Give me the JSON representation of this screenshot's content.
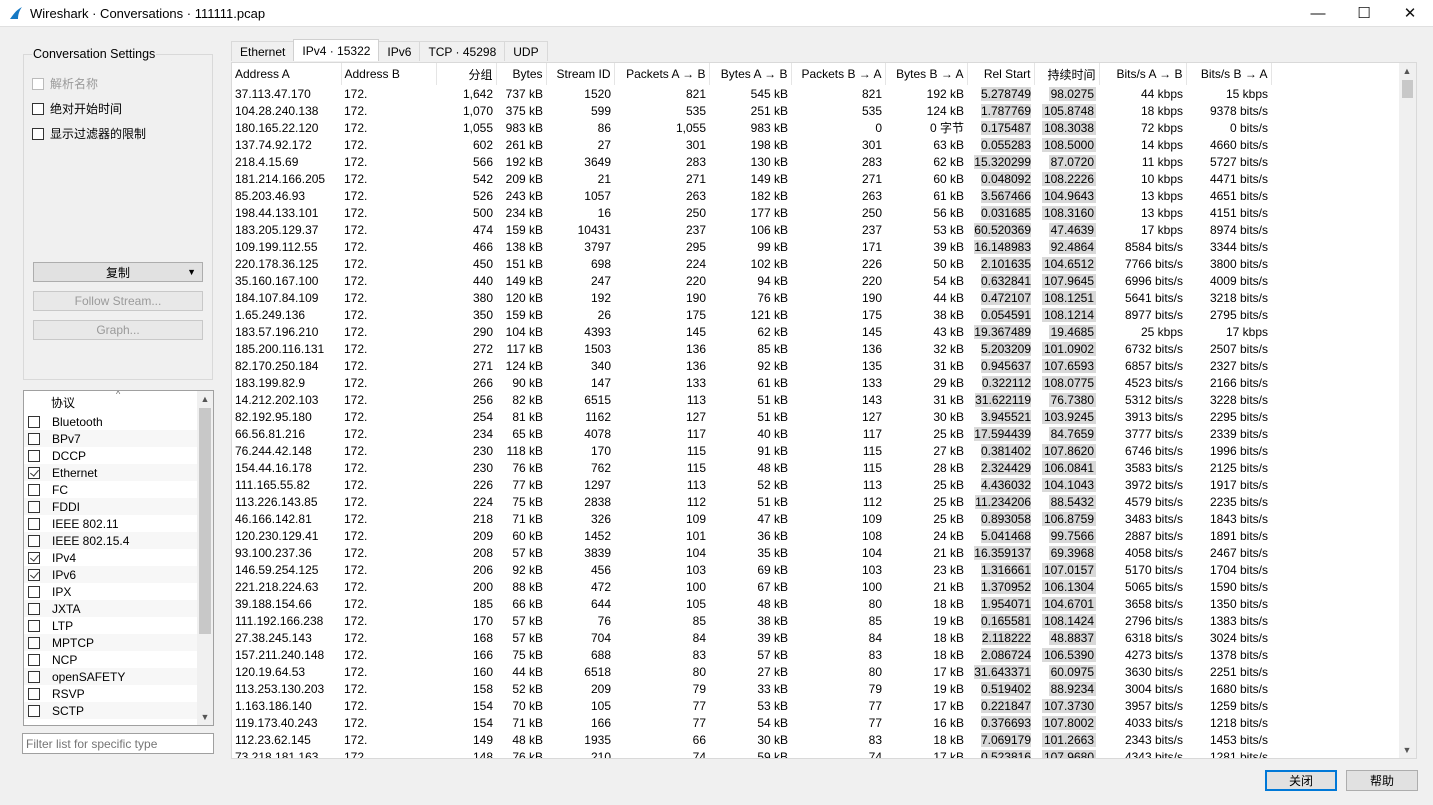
{
  "window": {
    "title": "Wireshark · Conversations · 111111.pcap",
    "minimize": "—",
    "maximize": "☐",
    "close": "✕"
  },
  "settings": {
    "title": "Conversation Settings",
    "name_resolution": "解析名称",
    "absolute_time": "绝对开始时间",
    "limit_to_filter": "显示过滤器的限制",
    "copy_button": "复制",
    "follow_stream_button": "Follow Stream...",
    "graph_button": "Graph..."
  },
  "protocols": {
    "header": "协议",
    "items": [
      {
        "label": "Bluetooth",
        "checked": false
      },
      {
        "label": "BPv7",
        "checked": false
      },
      {
        "label": "DCCP",
        "checked": false
      },
      {
        "label": "Ethernet",
        "checked": true
      },
      {
        "label": "FC",
        "checked": false
      },
      {
        "label": "FDDI",
        "checked": false
      },
      {
        "label": "IEEE 802.11",
        "checked": false
      },
      {
        "label": "IEEE 802.15.4",
        "checked": false
      },
      {
        "label": "IPv4",
        "checked": true
      },
      {
        "label": "IPv6",
        "checked": true
      },
      {
        "label": "IPX",
        "checked": false
      },
      {
        "label": "JXTA",
        "checked": false
      },
      {
        "label": "LTP",
        "checked": false
      },
      {
        "label": "MPTCP",
        "checked": false
      },
      {
        "label": "NCP",
        "checked": false
      },
      {
        "label": "openSAFETY",
        "checked": false
      },
      {
        "label": "RSVP",
        "checked": false
      },
      {
        "label": "SCTP",
        "checked": false
      }
    ],
    "filter_placeholder": "Filter list for specific type"
  },
  "tabs": [
    "Ethernet",
    "IPv4 · 15322",
    "IPv6",
    "TCP · 45298",
    "UDP"
  ],
  "table": {
    "columns": [
      "Address A",
      "Address B",
      "分组",
      "Bytes",
      "Stream ID",
      "Packets A → B",
      "Bytes A → B",
      "Packets B → A",
      "Bytes B → A",
      "Rel Start",
      "持续时间",
      "Bits/s A → B",
      "Bits/s B → A"
    ],
    "rows": [
      [
        "37.113.47.170",
        "172.",
        "1,642",
        "737 kB",
        "1520",
        "821",
        "545 kB",
        "821",
        "192 kB",
        "5.278749",
        "98.0275",
        "44 kbps",
        "15 kbps"
      ],
      [
        "104.28.240.138",
        "172.",
        "1,070",
        "375 kB",
        "599",
        "535",
        "251 kB",
        "535",
        "124 kB",
        "1.787769",
        "105.8748",
        "18 kbps",
        "9378 bits/s"
      ],
      [
        "180.165.22.120",
        "172.",
        "1,055",
        "983 kB",
        "86",
        "1,055",
        "983 kB",
        "0",
        "0 字节",
        "0.175487",
        "108.3038",
        "72 kbps",
        "0 bits/s"
      ],
      [
        "137.74.92.172",
        "172.",
        "602",
        "261 kB",
        "27",
        "301",
        "198 kB",
        "301",
        "63 kB",
        "0.055283",
        "108.5000",
        "14 kbps",
        "4660 bits/s"
      ],
      [
        "218.4.15.69",
        "172.",
        "566",
        "192 kB",
        "3649",
        "283",
        "130 kB",
        "283",
        "62 kB",
        "15.320299",
        "87.0720",
        "11 kbps",
        "5727 bits/s"
      ],
      [
        "181.214.166.205",
        "172.",
        "542",
        "209 kB",
        "21",
        "271",
        "149 kB",
        "271",
        "60 kB",
        "0.048092",
        "108.2226",
        "10 kbps",
        "4471 bits/s"
      ],
      [
        "85.203.46.93",
        "172.",
        "526",
        "243 kB",
        "1057",
        "263",
        "182 kB",
        "263",
        "61 kB",
        "3.567466",
        "104.9643",
        "13 kbps",
        "4651 bits/s"
      ],
      [
        "198.44.133.101",
        "172.",
        "500",
        "234 kB",
        "16",
        "250",
        "177 kB",
        "250",
        "56 kB",
        "0.031685",
        "108.3160",
        "13 kbps",
        "4151 bits/s"
      ],
      [
        "183.205.129.37",
        "172.",
        "474",
        "159 kB",
        "10431",
        "237",
        "106 kB",
        "237",
        "53 kB",
        "60.520369",
        "47.4639",
        "17 kbps",
        "8974 bits/s"
      ],
      [
        "109.199.112.55",
        "172.",
        "466",
        "138 kB",
        "3797",
        "295",
        "99 kB",
        "171",
        "39 kB",
        "16.148983",
        "92.4864",
        "8584 bits/s",
        "3344 bits/s"
      ],
      [
        "220.178.36.125",
        "172.",
        "450",
        "151 kB",
        "698",
        "224",
        "102 kB",
        "226",
        "50 kB",
        "2.101635",
        "104.6512",
        "7766 bits/s",
        "3800 bits/s"
      ],
      [
        "35.160.167.100",
        "172.",
        "440",
        "149 kB",
        "247",
        "220",
        "94 kB",
        "220",
        "54 kB",
        "0.632841",
        "107.9645",
        "6996 bits/s",
        "4009 bits/s"
      ],
      [
        "184.107.84.109",
        "172.",
        "380",
        "120 kB",
        "192",
        "190",
        "76 kB",
        "190",
        "44 kB",
        "0.472107",
        "108.1251",
        "5641 bits/s",
        "3218 bits/s"
      ],
      [
        "1.65.249.136",
        "172.",
        "350",
        "159 kB",
        "26",
        "175",
        "121 kB",
        "175",
        "38 kB",
        "0.054591",
        "108.1214",
        "8977 bits/s",
        "2795 bits/s"
      ],
      [
        "183.57.196.210",
        "172.",
        "290",
        "104 kB",
        "4393",
        "145",
        "62 kB",
        "145",
        "43 kB",
        "19.367489",
        "19.4685",
        "25 kbps",
        "17 kbps"
      ],
      [
        "185.200.116.131",
        "172.",
        "272",
        "117 kB",
        "1503",
        "136",
        "85 kB",
        "136",
        "32 kB",
        "5.203209",
        "101.0902",
        "6732 bits/s",
        "2507 bits/s"
      ],
      [
        "82.170.250.184",
        "172.",
        "271",
        "124 kB",
        "340",
        "136",
        "92 kB",
        "135",
        "31 kB",
        "0.945637",
        "107.6593",
        "6857 bits/s",
        "2327 bits/s"
      ],
      [
        "183.199.82.9",
        "172.",
        "266",
        "90 kB",
        "147",
        "133",
        "61 kB",
        "133",
        "29 kB",
        "0.322112",
        "108.0775",
        "4523 bits/s",
        "2166 bits/s"
      ],
      [
        "14.212.202.103",
        "172.",
        "256",
        "82 kB",
        "6515",
        "113",
        "51 kB",
        "143",
        "31 kB",
        "31.622119",
        "76.7380",
        "5312 bits/s",
        "3228 bits/s"
      ],
      [
        "82.192.95.180",
        "172.",
        "254",
        "81 kB",
        "1162",
        "127",
        "51 kB",
        "127",
        "30 kB",
        "3.945521",
        "103.9245",
        "3913 bits/s",
        "2295 bits/s"
      ],
      [
        "66.56.81.216",
        "172.",
        "234",
        "65 kB",
        "4078",
        "117",
        "40 kB",
        "117",
        "25 kB",
        "17.594439",
        "84.7659",
        "3777 bits/s",
        "2339 bits/s"
      ],
      [
        "76.244.42.148",
        "172.",
        "230",
        "118 kB",
        "170",
        "115",
        "91 kB",
        "115",
        "27 kB",
        "0.381402",
        "107.8620",
        "6746 bits/s",
        "1996 bits/s"
      ],
      [
        "154.44.16.178",
        "172.",
        "230",
        "76 kB",
        "762",
        "115",
        "48 kB",
        "115",
        "28 kB",
        "2.324429",
        "106.0841",
        "3583 bits/s",
        "2125 bits/s"
      ],
      [
        "111.165.55.82",
        "172.",
        "226",
        "77 kB",
        "1297",
        "113",
        "52 kB",
        "113",
        "25 kB",
        "4.436032",
        "104.1043",
        "3972 bits/s",
        "1917 bits/s"
      ],
      [
        "113.226.143.85",
        "172.",
        "224",
        "75 kB",
        "2838",
        "112",
        "51 kB",
        "112",
        "25 kB",
        "11.234206",
        "88.5432",
        "4579 bits/s",
        "2235 bits/s"
      ],
      [
        "46.166.142.81",
        "172.",
        "218",
        "71 kB",
        "326",
        "109",
        "47 kB",
        "109",
        "25 kB",
        "0.893058",
        "106.8759",
        "3483 bits/s",
        "1843 bits/s"
      ],
      [
        "120.230.129.41",
        "172.",
        "209",
        "60 kB",
        "1452",
        "101",
        "36 kB",
        "108",
        "24 kB",
        "5.041468",
        "99.7566",
        "2887 bits/s",
        "1891 bits/s"
      ],
      [
        "93.100.237.36",
        "172.",
        "208",
        "57 kB",
        "3839",
        "104",
        "35 kB",
        "104",
        "21 kB",
        "16.359137",
        "69.3968",
        "4058 bits/s",
        "2467 bits/s"
      ],
      [
        "146.59.254.125",
        "172.",
        "206",
        "92 kB",
        "456",
        "103",
        "69 kB",
        "103",
        "23 kB",
        "1.316661",
        "107.0157",
        "5170 bits/s",
        "1704 bits/s"
      ],
      [
        "221.218.224.63",
        "172.",
        "200",
        "88 kB",
        "472",
        "100",
        "67 kB",
        "100",
        "21 kB",
        "1.370952",
        "106.1304",
        "5065 bits/s",
        "1590 bits/s"
      ],
      [
        "39.188.154.66",
        "172.",
        "185",
        "66 kB",
        "644",
        "105",
        "48 kB",
        "80",
        "18 kB",
        "1.954071",
        "104.6701",
        "3658 bits/s",
        "1350 bits/s"
      ],
      [
        "111.192.166.238",
        "172.",
        "170",
        "57 kB",
        "76",
        "85",
        "38 kB",
        "85",
        "19 kB",
        "0.165581",
        "108.1424",
        "2796 bits/s",
        "1383 bits/s"
      ],
      [
        "27.38.245.143",
        "172.",
        "168",
        "57 kB",
        "704",
        "84",
        "39 kB",
        "84",
        "18 kB",
        "2.118222",
        "48.8837",
        "6318 bits/s",
        "3024 bits/s"
      ],
      [
        "157.211.240.148",
        "172.",
        "166",
        "75 kB",
        "688",
        "83",
        "57 kB",
        "83",
        "18 kB",
        "2.086724",
        "106.5390",
        "4273 bits/s",
        "1378 bits/s"
      ],
      [
        "120.19.64.53",
        "172.",
        "160",
        "44 kB",
        "6518",
        "80",
        "27 kB",
        "80",
        "17 kB",
        "31.643371",
        "60.0975",
        "3630 bits/s",
        "2251 bits/s"
      ],
      [
        "113.253.130.203",
        "172.",
        "158",
        "52 kB",
        "209",
        "79",
        "33 kB",
        "79",
        "19 kB",
        "0.519402",
        "88.9234",
        "3004 bits/s",
        "1680 bits/s"
      ],
      [
        "1.163.186.140",
        "172.",
        "154",
        "70 kB",
        "105",
        "77",
        "53 kB",
        "77",
        "17 kB",
        "0.221847",
        "107.3730",
        "3957 bits/s",
        "1259 bits/s"
      ],
      [
        "119.173.40.243",
        "172.",
        "154",
        "71 kB",
        "166",
        "77",
        "54 kB",
        "77",
        "16 kB",
        "0.376693",
        "107.8002",
        "4033 bits/s",
        "1218 bits/s"
      ],
      [
        "112.23.62.145",
        "172.",
        "149",
        "48 kB",
        "1935",
        "66",
        "30 kB",
        "83",
        "18 kB",
        "7.069179",
        "101.2663",
        "2343 bits/s",
        "1453 bits/s"
      ],
      [
        "73.218.181.163",
        "172.",
        "148",
        "76 kB",
        "210",
        "74",
        "59 kB",
        "74",
        "17 kB",
        "0.523816",
        "107.9680",
        "4343 bits/s",
        "1281 bits/s"
      ]
    ]
  },
  "bottom": {
    "close_button": "关闭",
    "help_button": "帮助"
  }
}
